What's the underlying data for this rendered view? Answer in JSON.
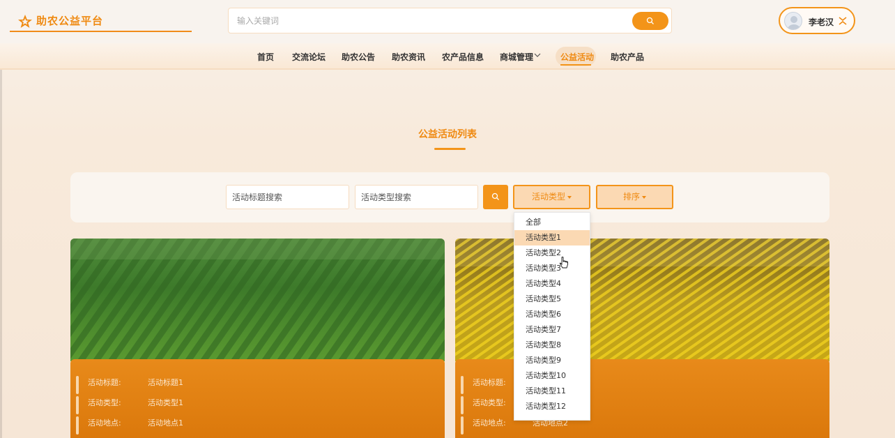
{
  "header": {
    "brand": "助农公益平台",
    "search_placeholder": "输入关键词",
    "user_name": "李老汉"
  },
  "nav": {
    "items": [
      "首页",
      "交流论坛",
      "助农公告",
      "助农资讯",
      "农产品信息",
      "商城管理",
      "公益活动",
      "助农产品"
    ],
    "active": "公益活动"
  },
  "page": {
    "title": "公益活动列表"
  },
  "filters": {
    "title_placeholder": "活动标题搜索",
    "type_placeholder": "活动类型搜索",
    "type_button": "活动类型",
    "sort_button": "排序"
  },
  "dropdown": {
    "options": [
      "全部",
      "活动类型1",
      "活动类型2",
      "活动类型3",
      "活动类型4",
      "活动类型5",
      "活动类型6",
      "活动类型7",
      "活动类型8",
      "活动类型9",
      "活动类型10",
      "活动类型11",
      "活动类型12"
    ],
    "highlighted": "活动类型1"
  },
  "cards": [
    {
      "labels": {
        "title": "活动标题:",
        "type": "活动类型:",
        "location": "活动地点:"
      },
      "values": {
        "title": "活动标题1",
        "type": "活动类型1",
        "location": "活动地点1"
      }
    },
    {
      "labels": {
        "title": "活动标题:",
        "type": "活动类型:",
        "location": "活动地点:"
      },
      "values": {
        "title": "",
        "type": "",
        "location": "活动地点2"
      }
    }
  ],
  "colors": {
    "accent": "#f39419",
    "accent_text": "#ef8a12",
    "highlight": "#fbd9b3"
  },
  "icons": [
    "star-logo-icon",
    "search-icon",
    "avatar-icon",
    "logout-icon",
    "chevron-down-icon",
    "caret-down-icon",
    "pointer-cursor-icon"
  ]
}
